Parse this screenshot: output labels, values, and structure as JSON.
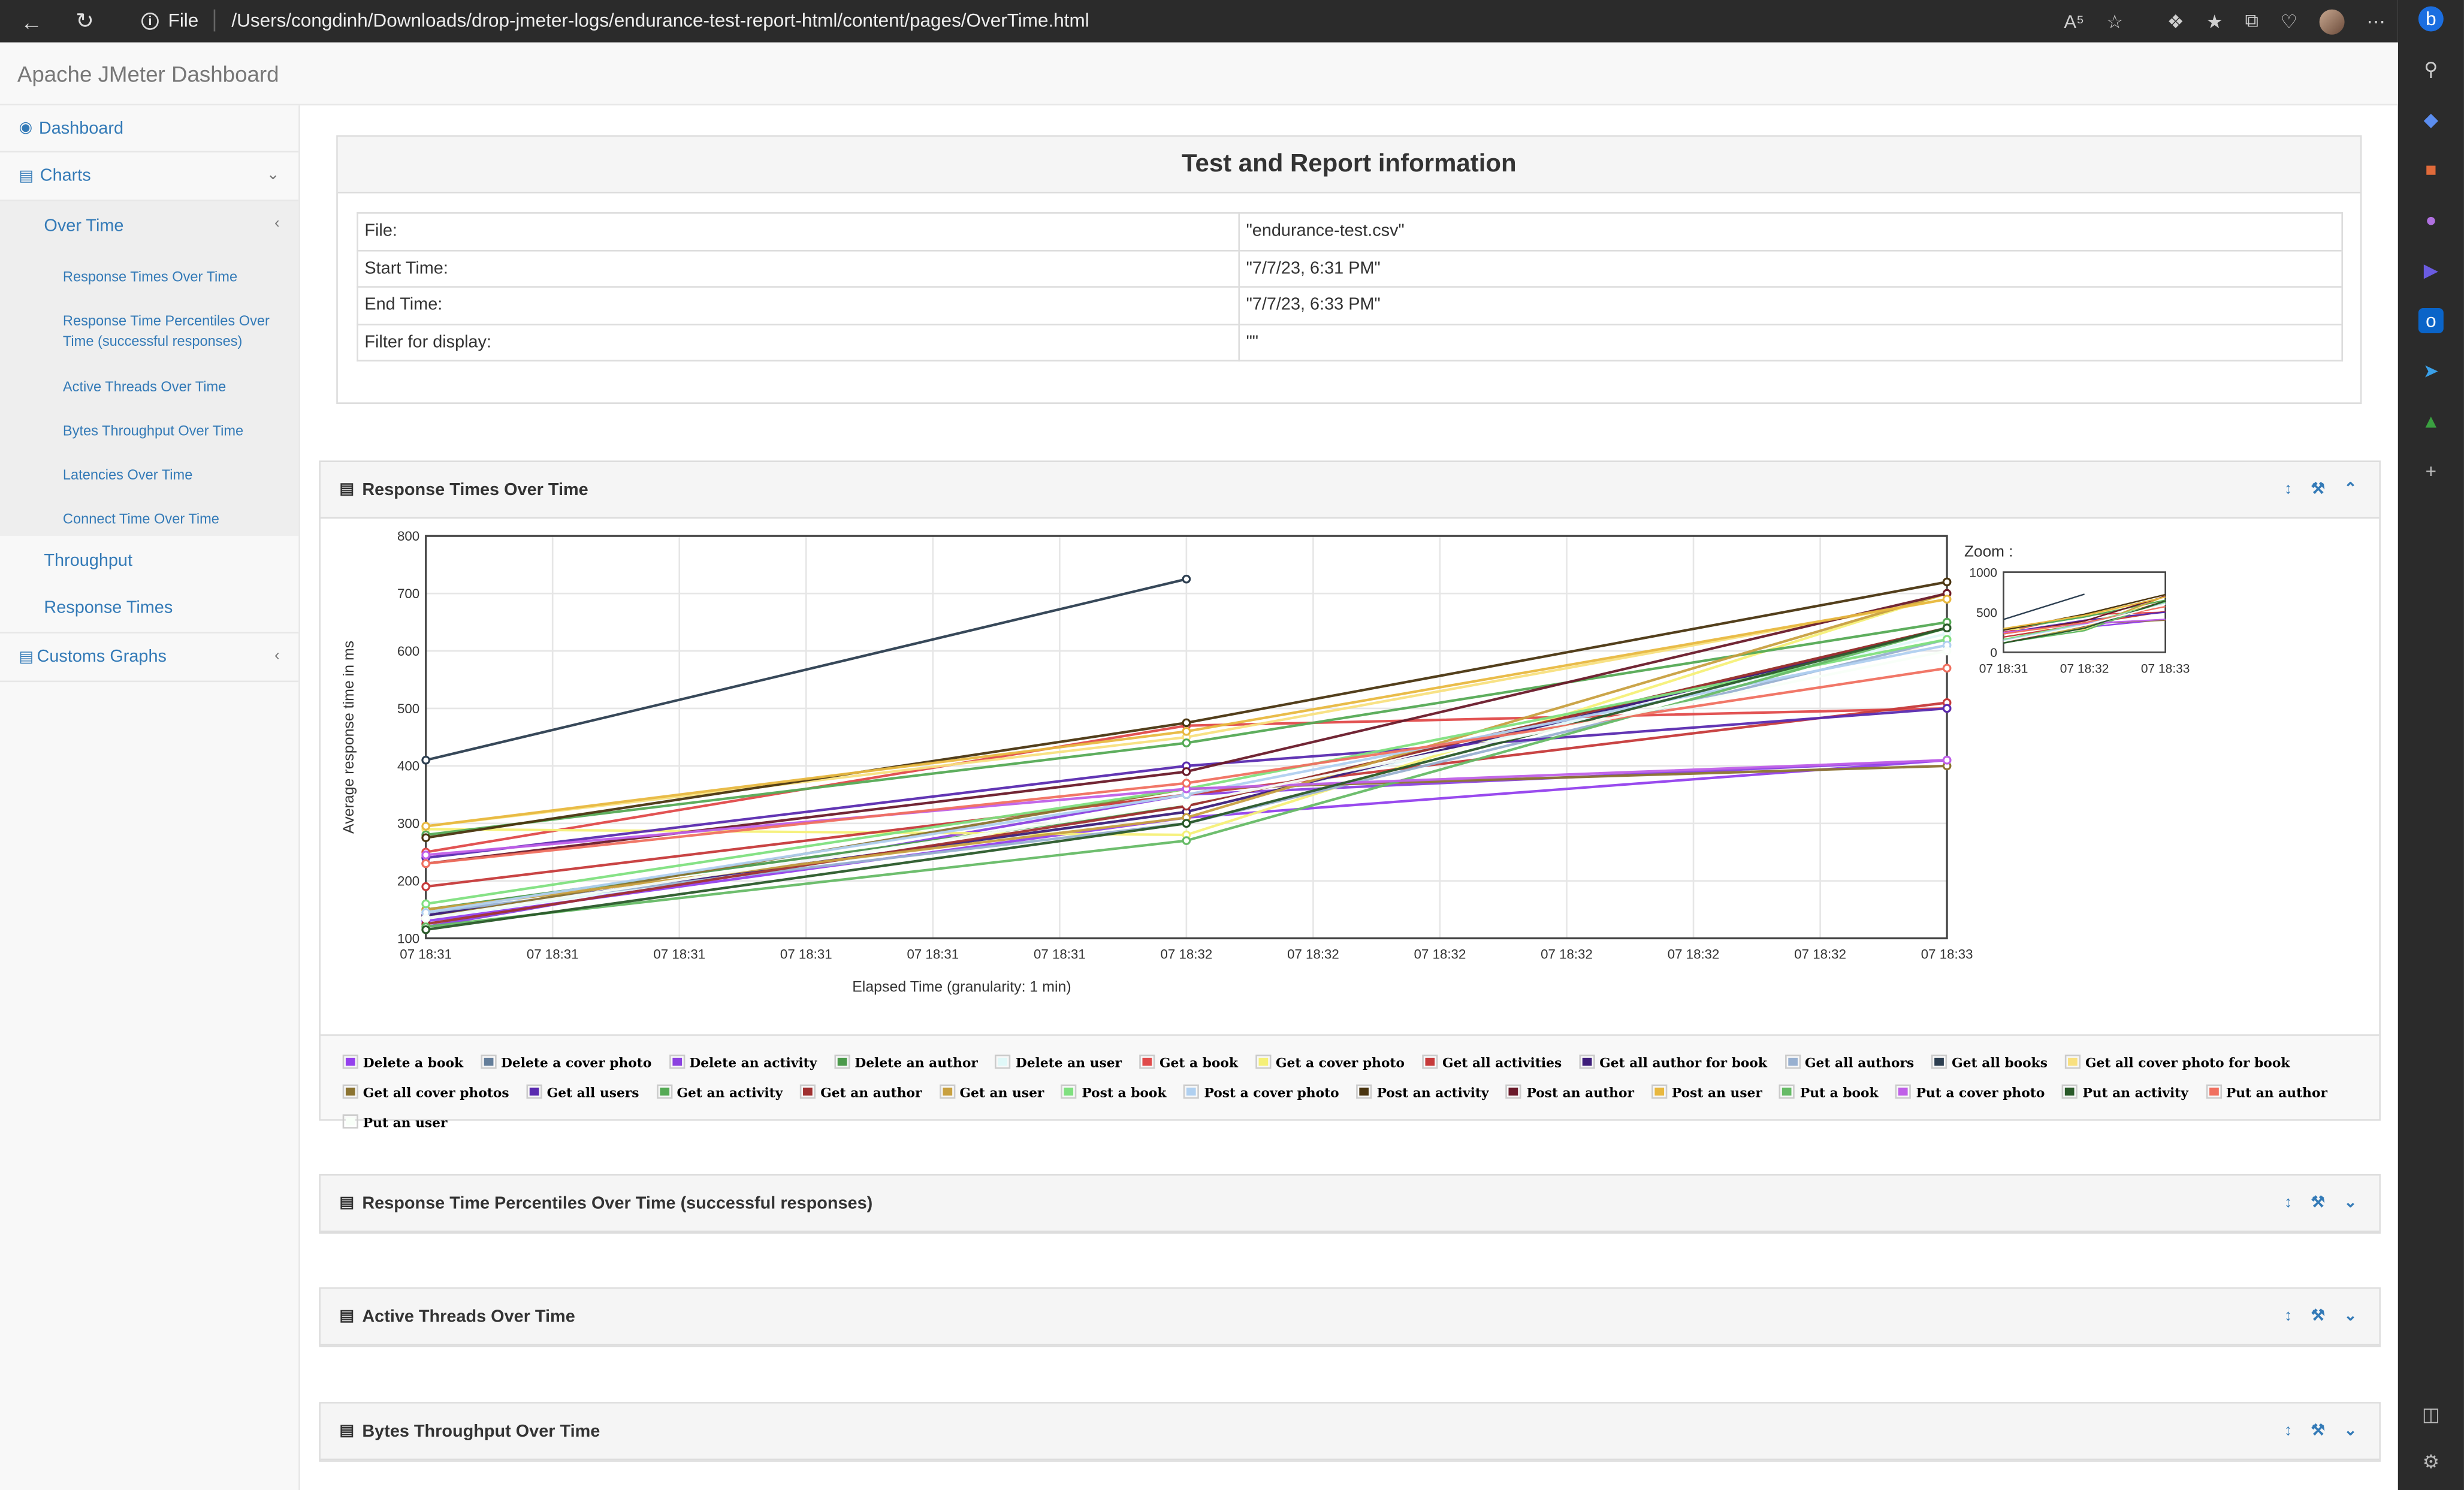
{
  "browser": {
    "protocol_label": "File",
    "url": "/Users/congdinh/Downloads/drop-jmeter-logs/endurance-test-report-html/content/pages/OverTime.html"
  },
  "app": {
    "title": "Apache JMeter Dashboard"
  },
  "sidebar": {
    "dashboard": "Dashboard",
    "charts": "Charts",
    "over_time": "Over Time",
    "sub_items": [
      "Response Times Over Time",
      "Response Time Percentiles Over Time (successful responses)",
      "Active Threads Over Time",
      "Bytes Throughput Over Time",
      "Latencies Over Time",
      "Connect Time Over Time"
    ],
    "throughput": "Throughput",
    "response_times": "Response Times",
    "customs_graphs": "Customs Graphs"
  },
  "report_info": {
    "title": "Test and Report information",
    "rows": [
      {
        "label": "File:",
        "value": "\"endurance-test.csv\""
      },
      {
        "label": "Start Time:",
        "value": "\"7/7/23, 6:31 PM\""
      },
      {
        "label": "End Time:",
        "value": "\"7/7/23, 6:33 PM\""
      },
      {
        "label": "Filter for display:",
        "value": "\"\""
      }
    ]
  },
  "panels": {
    "response_times": "Response Times Over Time",
    "percentiles": "Response Time Percentiles Over Time (successful responses)",
    "active_threads": "Active Threads Over Time",
    "bytes_throughput": "Bytes Throughput Over Time"
  },
  "icons": {
    "tool_icons": [
      "resize-icon",
      "wrench-icon",
      "collapse-icon"
    ]
  },
  "chart_data": {
    "type": "line",
    "xlabel": "Elapsed Time (granularity: 1 min)",
    "ylabel": "Average response time in ms",
    "ylim": [
      100,
      800
    ],
    "yticks": [
      100,
      200,
      300,
      400,
      500,
      600,
      700,
      800
    ],
    "xtick_labels": [
      "07 18:31",
      "07 18:31",
      "07 18:31",
      "07 18:31",
      "07 18:31",
      "07 18:31",
      "07 18:32",
      "07 18:32",
      "07 18:32",
      "07 18:32",
      "07 18:32",
      "07 18:32",
      "07 18:33"
    ],
    "x_positions": [
      0,
      6,
      12
    ],
    "grid": true,
    "zoom": {
      "label": "Zoom :",
      "yticks": [
        0,
        500,
        1000
      ],
      "xtick_labels": [
        "07 18:31",
        "07 18:32",
        "07 18:33"
      ]
    },
    "series": [
      {
        "name": "Delete a book",
        "color": "#9440ed",
        "values": [
          130,
          310,
          410
        ]
      },
      {
        "name": "Delete a cover photo",
        "color": "#647e9a",
        "values": [
          140,
          320,
          640
        ]
      },
      {
        "name": "Delete an activity",
        "color": "#8b42e0",
        "values": [
          120,
          350,
          410
        ]
      },
      {
        "name": "Delete an author",
        "color": "#4c9a4c",
        "values": [
          150,
          330,
          640
        ]
      },
      {
        "name": "Delete an user",
        "color": "#e0f8f8",
        "values": [
          135,
          320,
          630
        ]
      },
      {
        "name": "Get a book",
        "color": "#e04a4a",
        "values": [
          250,
          470,
          500
        ]
      },
      {
        "name": "Get a cover photo",
        "color": "#f5f078",
        "values": [
          290,
          280,
          700
        ]
      },
      {
        "name": "Get all activities",
        "color": "#c63a3a",
        "values": [
          190,
          350,
          510
        ]
      },
      {
        "name": "Get all author for book",
        "color": "#3e1e7a",
        "values": [
          140,
          320,
          640
        ]
      },
      {
        "name": "Get all authors",
        "color": "#98b0d0",
        "values": [
          145,
          300,
          620
        ]
      },
      {
        "name": "Get all books",
        "color": "#2c3e50",
        "values": [
          410,
          725,
          null
        ]
      },
      {
        "name": "Get all cover photo for book",
        "color": "#f8e080",
        "values": [
          295,
          450,
          690
        ]
      },
      {
        "name": "Get all cover photos",
        "color": "#8b7330",
        "values": [
          135,
          360,
          400
        ]
      },
      {
        "name": "Get all users",
        "color": "#5a2bb0",
        "values": [
          240,
          400,
          500
        ]
      },
      {
        "name": "Get an activity",
        "color": "#55aa55",
        "values": [
          280,
          440,
          650
        ]
      },
      {
        "name": "Get an author",
        "color": "#a03030",
        "values": [
          125,
          330,
          640
        ]
      },
      {
        "name": "Get an user",
        "color": "#c8a040",
        "values": [
          150,
          310,
          700
        ]
      },
      {
        "name": "Post a book",
        "color": "#80e080",
        "values": [
          160,
          360,
          620
        ]
      },
      {
        "name": "Post a cover photo",
        "color": "#b0d0f0",
        "values": [
          145,
          350,
          610
        ]
      },
      {
        "name": "Post an activity",
        "color": "#4a3510",
        "values": [
          275,
          475,
          720
        ]
      },
      {
        "name": "Post an author",
        "color": "#6a1a2a",
        "values": [
          230,
          390,
          700
        ]
      },
      {
        "name": "Post an user",
        "color": "#e8b840",
        "values": [
          295,
          460,
          690
        ]
      },
      {
        "name": "Put a book",
        "color": "#66bb66",
        "values": [
          120,
          270,
          640
        ]
      },
      {
        "name": "Put a cover photo",
        "color": "#c060e8",
        "values": [
          245,
          360,
          410
        ]
      },
      {
        "name": "Put an activity",
        "color": "#2a5a2a",
        "values": [
          115,
          300,
          640
        ]
      },
      {
        "name": "Put an author",
        "color": "#f07060",
        "values": [
          230,
          370,
          570
        ]
      },
      {
        "name": "Put an user",
        "color": "#f8fff8",
        "values": [
          135,
          335,
          600
        ]
      }
    ]
  }
}
